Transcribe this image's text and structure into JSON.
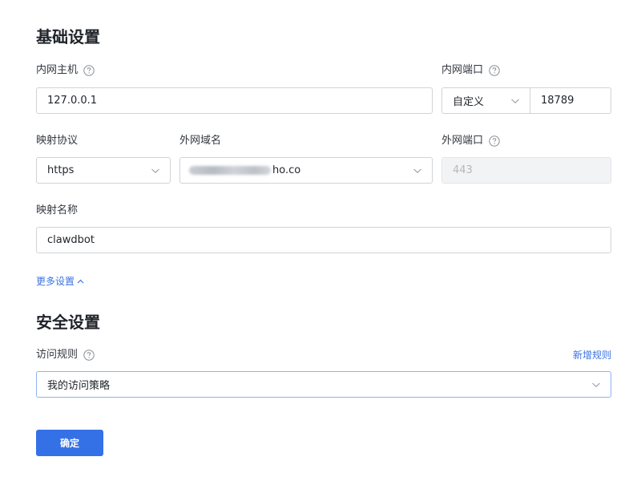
{
  "basic_settings": {
    "title": "基础设置",
    "intranet_host": {
      "label": "内网主机",
      "value": "127.0.0.1"
    },
    "intranet_port": {
      "label": "内网端口",
      "mode": "自定义",
      "value": "18789"
    },
    "mapping_protocol": {
      "label": "映射协议",
      "value": "https"
    },
    "external_domain": {
      "label": "外网域名",
      "value_suffix": "ho.co"
    },
    "external_port": {
      "label": "外网端口",
      "placeholder": "443"
    },
    "mapping_name": {
      "label": "映射名称",
      "value": "clawdbot"
    },
    "more_settings_link": "更多设置"
  },
  "security_settings": {
    "title": "安全设置",
    "access_rules": {
      "label": "访问规则",
      "add_rule_link": "新增规则",
      "value": "我的访问策略"
    }
  },
  "actions": {
    "confirm_label": "确定"
  },
  "colors": {
    "primary": "#3471e6",
    "link": "#3a73e0",
    "border": "#d0d3d6",
    "disabled_bg": "#f2f3f5"
  },
  "icons": {
    "help": "question-circle-icon",
    "dropdown": "chevron-down-icon",
    "collapse": "chevron-up-icon"
  }
}
